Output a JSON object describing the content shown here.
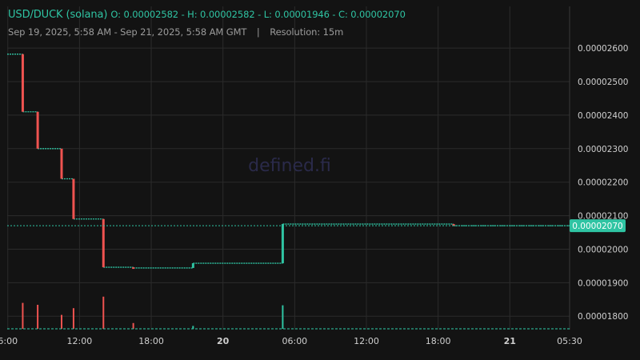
{
  "header": {
    "symbol": "USD/DUCK (solana)",
    "ohlc": "O: 0.00002582 - H: 0.00002582 - L: 0.00001946 - C: 0.00002070",
    "range": "Sep 19, 2025, 5:58 AM - Sep 21, 2025, 5:58 AM GMT",
    "separator": "|",
    "resolution": "Resolution: 15m"
  },
  "watermark": "defined.fi",
  "last_price_label": "0.00002070",
  "colors": {
    "background": "#131313",
    "grid": "#2b2b2b",
    "up": "#2fc4a3",
    "down": "#ef5350",
    "axis_text": "#cfcfcf",
    "watermark": "#2a2a4a"
  },
  "chart_data": {
    "type": "candlestick",
    "x_unit": "hours since Sep 19, 2025 5:00 AM GMT",
    "xlim": [
      0.95,
      48.0
    ],
    "ylim": [
      1.76e-05,
      2.66e-05
    ],
    "y_ticks": [
      "0.00002600",
      "0.00002500",
      "0.00002400",
      "0.00002300",
      "0.00002200",
      "0.00002100",
      "0.00002000",
      "0.00001900",
      "0.00001800"
    ],
    "y_tick_values": [
      2.6e-05,
      2.5e-05,
      2.4e-05,
      2.3e-05,
      2.2e-05,
      2.1e-05,
      2e-05,
      1.9e-05,
      1.8e-05
    ],
    "x_ticks": [
      {
        "label": "6:00",
        "t": 1.0
      },
      {
        "label": "12:00",
        "t": 7.0
      },
      {
        "label": "18:00",
        "t": 13.0
      },
      {
        "label": "20",
        "t": 19.0,
        "bold": true
      },
      {
        "label": "06:00",
        "t": 25.0
      },
      {
        "label": "12:00",
        "t": 31.0
      },
      {
        "label": "18:00",
        "t": 37.0
      },
      {
        "label": "21",
        "t": 43.0,
        "bold": true
      },
      {
        "label": "05:30",
        "t": 48.0
      }
    ],
    "last_price": 2.07e-05,
    "ohlc": {
      "open": 2.582e-05,
      "high": 2.582e-05,
      "low": 1.946e-05,
      "close": 2.07e-05
    },
    "segments": [
      {
        "t0": 0.95,
        "t1": 2.25,
        "price": 2.582e-05
      },
      {
        "t0": 2.25,
        "t1": 3.5,
        "price": 2.41e-05
      },
      {
        "t0": 3.5,
        "t1": 5.5,
        "price": 2.3e-05
      },
      {
        "t0": 5.5,
        "t1": 6.5,
        "price": 2.21e-05
      },
      {
        "t0": 6.5,
        "t1": 9.0,
        "price": 2.09e-05
      },
      {
        "t0": 9.0,
        "t1": 11.5,
        "price": 1.946e-05
      },
      {
        "t0": 11.5,
        "t1": 16.5,
        "price": 1.944e-05
      },
      {
        "t0": 16.5,
        "t1": 24.0,
        "price": 1.958e-05
      },
      {
        "t0": 24.0,
        "t1": 38.3,
        "price": 2.075e-05
      },
      {
        "t0": 38.3,
        "t1": 48.0,
        "price": 2.07e-05
      }
    ],
    "candles": [
      {
        "t": 2.25,
        "open": 2.582e-05,
        "high": 2.582e-05,
        "low": 2.41e-05,
        "close": 2.41e-05
      },
      {
        "t": 3.5,
        "open": 2.41e-05,
        "high": 2.41e-05,
        "low": 2.3e-05,
        "close": 2.3e-05
      },
      {
        "t": 5.5,
        "open": 2.3e-05,
        "high": 2.3e-05,
        "low": 2.21e-05,
        "close": 2.21e-05
      },
      {
        "t": 6.5,
        "open": 2.21e-05,
        "high": 2.21e-05,
        "low": 2.09e-05,
        "close": 2.09e-05
      },
      {
        "t": 9.0,
        "open": 2.09e-05,
        "high": 2.09e-05,
        "low": 1.946e-05,
        "close": 1.946e-05
      },
      {
        "t": 11.5,
        "open": 1.946e-05,
        "high": 1.946e-05,
        "low": 1.944e-05,
        "close": 1.944e-05
      },
      {
        "t": 16.5,
        "open": 1.944e-05,
        "high": 1.958e-05,
        "low": 1.944e-05,
        "close": 1.958e-05
      },
      {
        "t": 24.0,
        "open": 1.958e-05,
        "high": 2.075e-05,
        "low": 1.958e-05,
        "close": 2.075e-05
      },
      {
        "t": 38.3,
        "open": 2.075e-05,
        "high": 2.075e-05,
        "low": 2.07e-05,
        "close": 2.07e-05
      }
    ],
    "volumes": [
      {
        "t": 2.25,
        "value": 0.54,
        "dir": "down"
      },
      {
        "t": 3.5,
        "value": 0.5,
        "dir": "down"
      },
      {
        "t": 5.5,
        "value": 0.29,
        "dir": "down"
      },
      {
        "t": 6.5,
        "value": 0.43,
        "dir": "down"
      },
      {
        "t": 9.0,
        "value": 0.67,
        "dir": "down"
      },
      {
        "t": 11.5,
        "value": 0.12,
        "dir": "down"
      },
      {
        "t": 16.5,
        "value": 0.06,
        "dir": "up"
      },
      {
        "t": 24.0,
        "value": 0.49,
        "dir": "up"
      }
    ]
  }
}
